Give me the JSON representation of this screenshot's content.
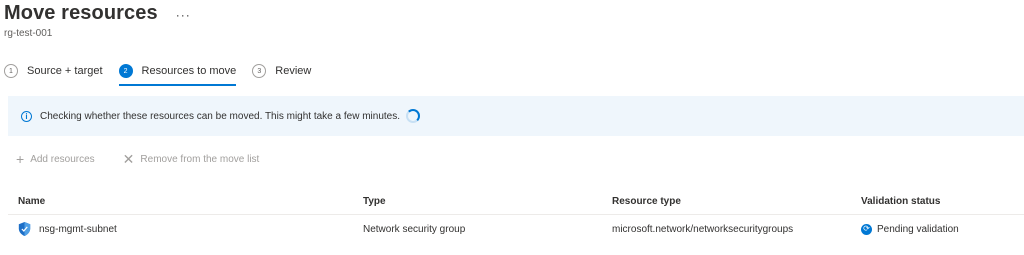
{
  "header": {
    "title": "Move resources",
    "more_label": "···",
    "subtitle": "rg-test-001"
  },
  "steps": [
    {
      "num": "1",
      "label": "Source + target",
      "active": false
    },
    {
      "num": "2",
      "label": "Resources to move",
      "active": true
    },
    {
      "num": "3",
      "label": "Review",
      "active": false
    }
  ],
  "info": {
    "icon": "info-icon",
    "text": "Checking whether these resources can be moved. This might take a few minutes."
  },
  "toolbar": {
    "add_label": "Add resources",
    "remove_label": "Remove from the move list"
  },
  "table": {
    "columns": [
      "Name",
      "Type",
      "Resource type",
      "Validation status"
    ],
    "rows": [
      {
        "name": "nsg-mgmt-subnet",
        "type": "Network security group",
        "resource_type": "microsoft.network/networksecuritygroups",
        "status": "Pending validation"
      }
    ]
  },
  "colors": {
    "accent": "#0078d4",
    "info_bg": "#eff6fc",
    "disabled": "#a19f9d"
  }
}
